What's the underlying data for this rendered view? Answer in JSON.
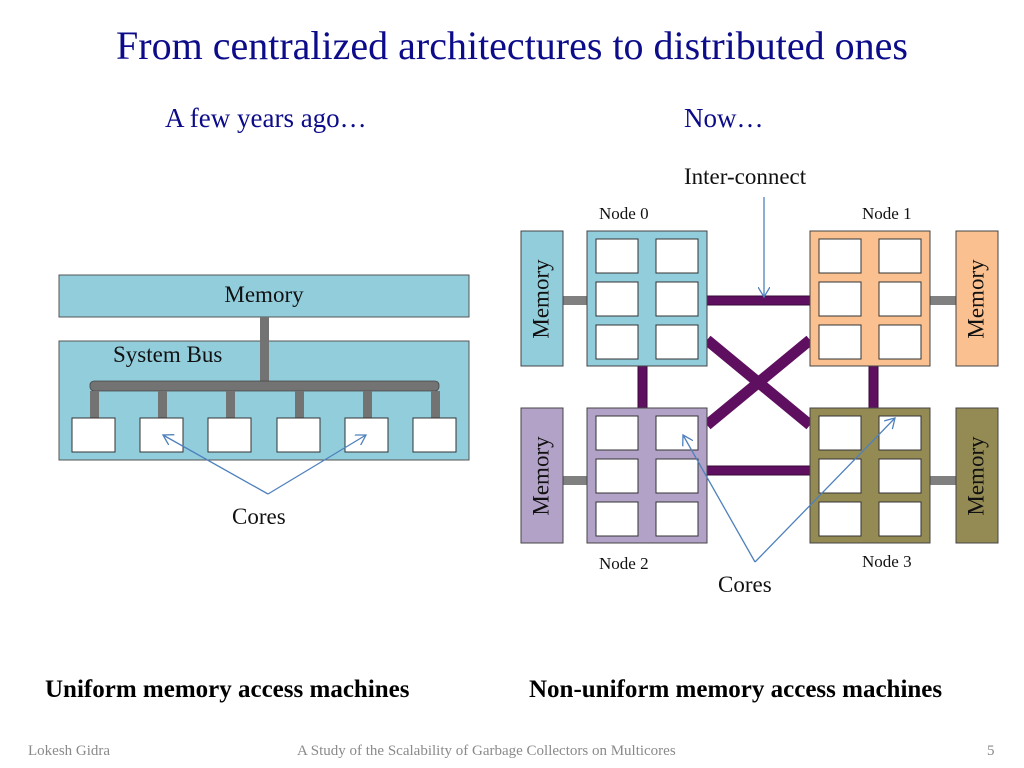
{
  "slide": {
    "title": "From centralized architectures to distributed ones",
    "left_heading": "A few years ago…",
    "right_heading": "Now…",
    "page_number": "5"
  },
  "uma": {
    "memory_label": "Memory",
    "bus_label": "System Bus",
    "cores_label": "Cores",
    "core_count": 6,
    "caption": "Uniform memory access machines",
    "colors": {
      "memory": "#92cddc",
      "bus": "#737373",
      "arrow": "#4f81bd"
    }
  },
  "numa": {
    "interconnect_label": "Inter-connect",
    "cores_label": "Cores",
    "caption": "Non-uniform memory access machines",
    "interconnect_color": "#5f0f5f",
    "nodes": [
      {
        "name": "Node 0",
        "memory_label": "Memory",
        "color": "#92cddc"
      },
      {
        "name": "Node 1",
        "memory_label": "Memory",
        "color": "#fac090"
      },
      {
        "name": "Node 2",
        "memory_label": "Memory",
        "color": "#b3a2c7"
      },
      {
        "name": "Node 3",
        "memory_label": "Memory",
        "color": "#948a54"
      }
    ],
    "cores_per_node": 6
  },
  "footer": {
    "author": "Lokesh Gidra",
    "talk_title": "A Study of the Scalability of Garbage Collectors on Multicores"
  }
}
